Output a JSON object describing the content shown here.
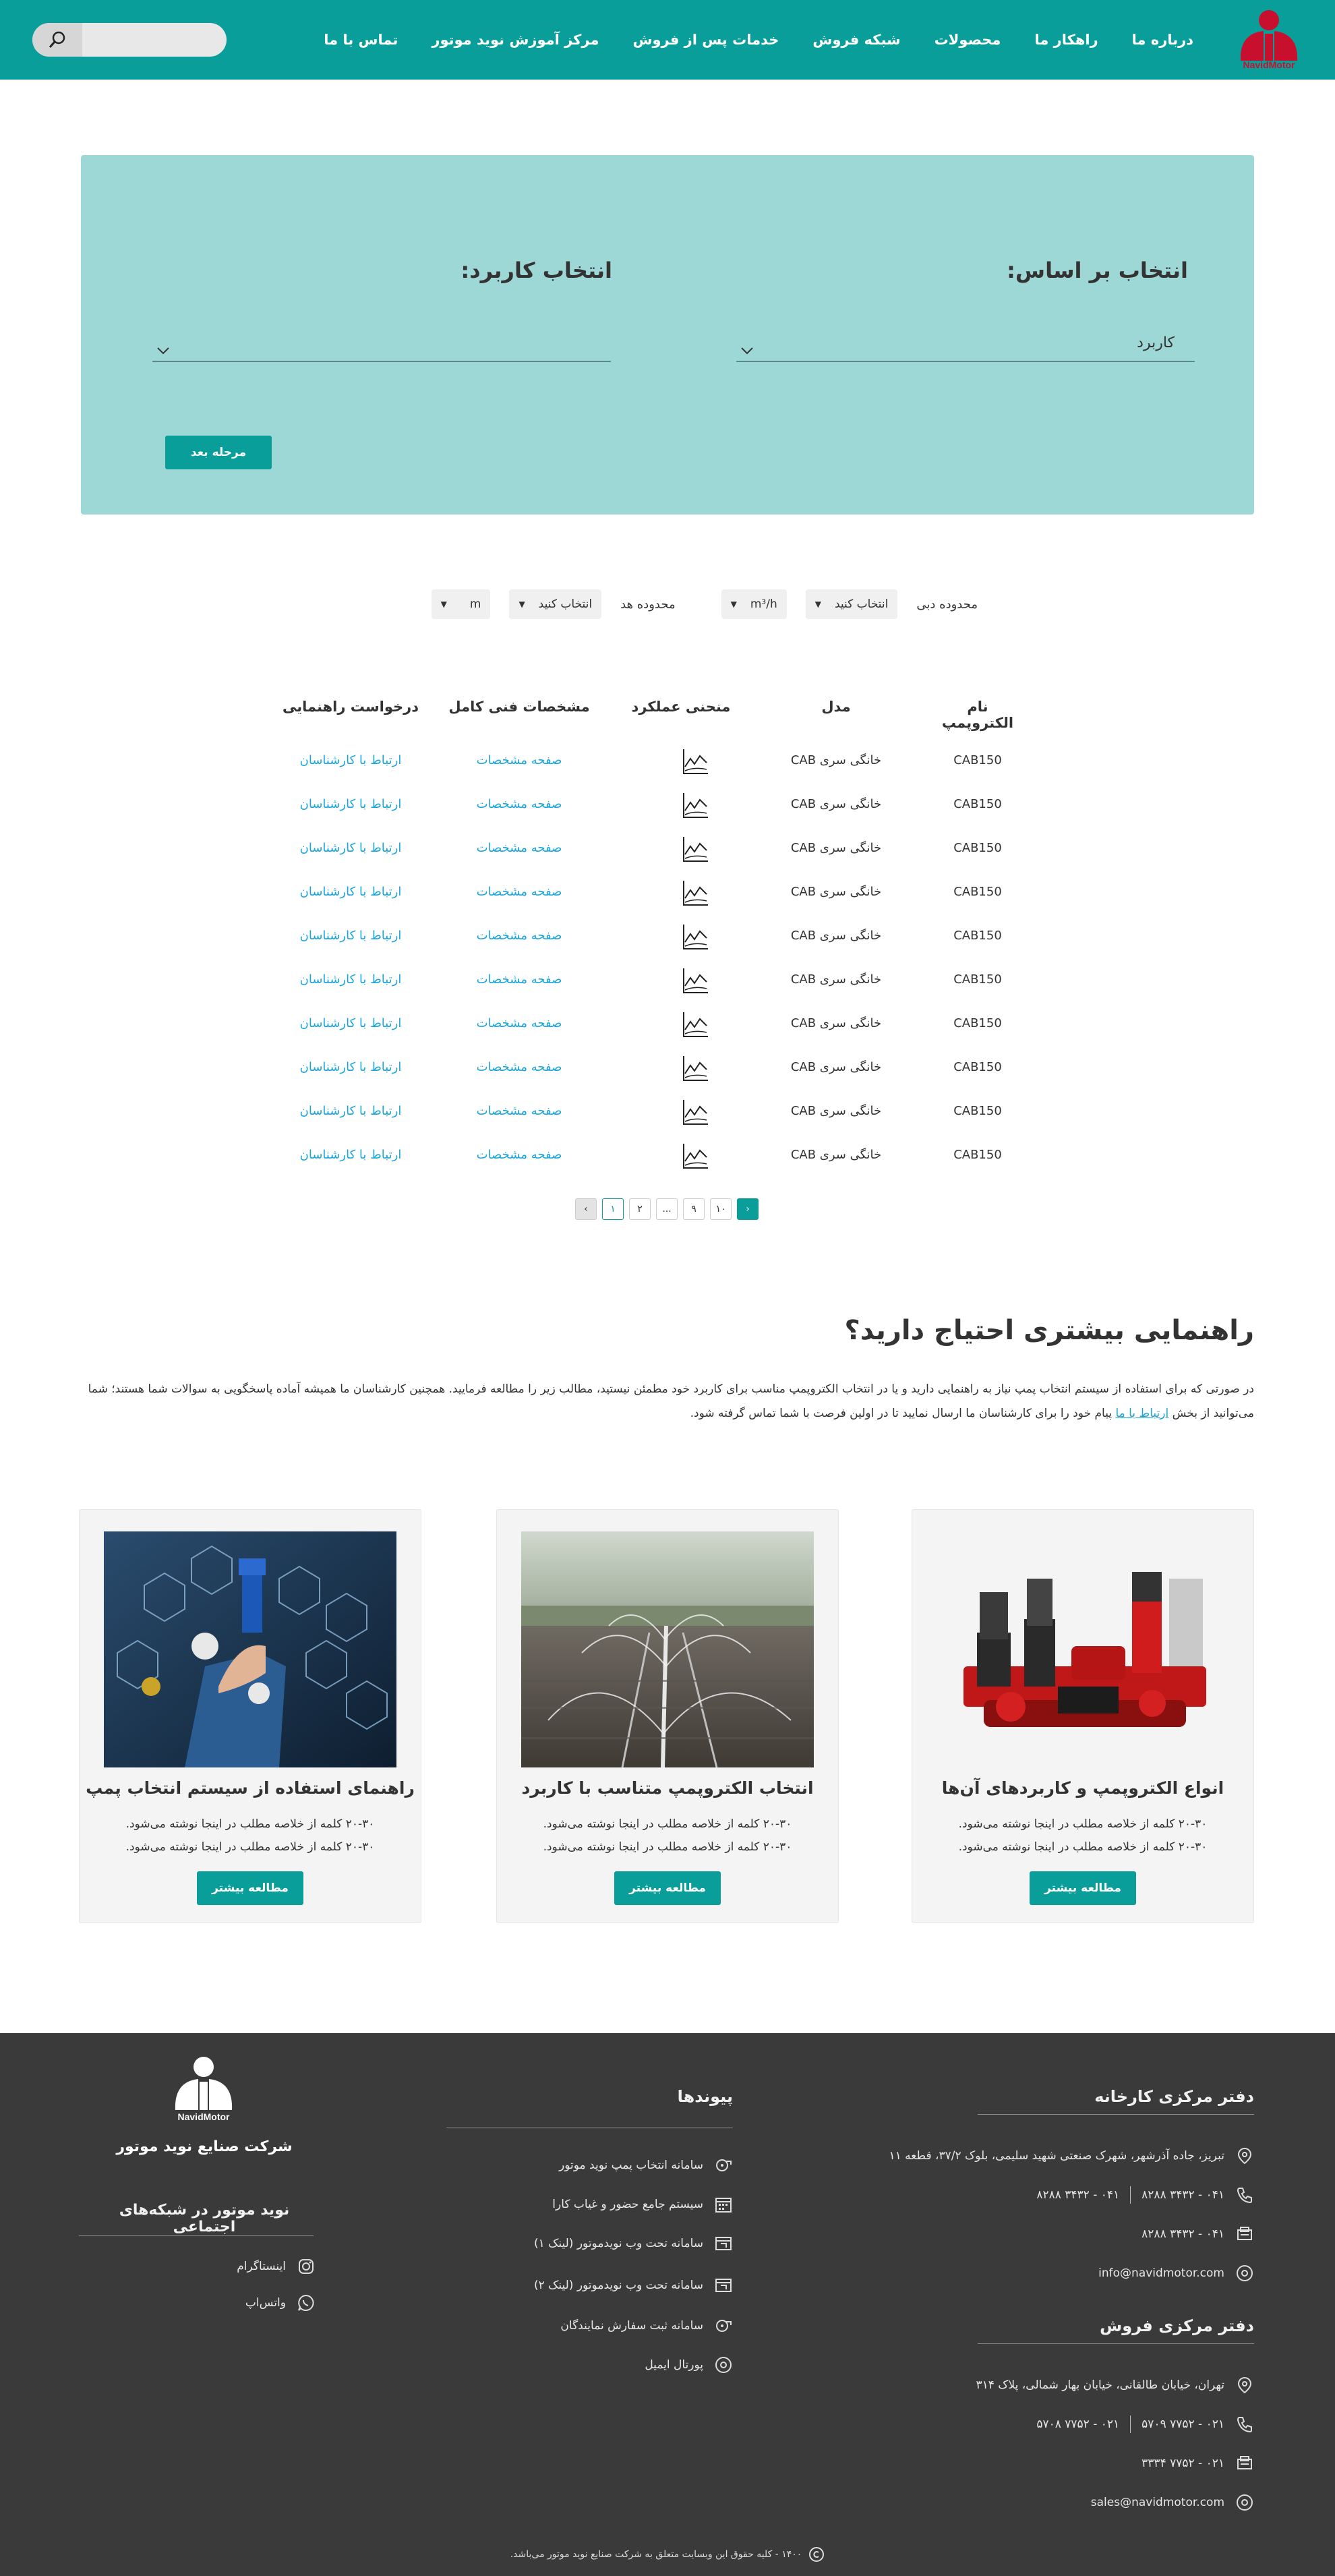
{
  "header": {
    "logo_text": "NavidMotor",
    "nav": [
      "درباره ما",
      "راهکار ما",
      "محصولات",
      "شبکه فروش",
      "خدمات پس از فروش",
      "مرکز آموزش نوید موتور",
      "تماس با ما"
    ],
    "search_placeholder": "",
    "colors": {
      "primary": "#0a9e9a",
      "logo_red": "#c8102e"
    }
  },
  "selection": {
    "basis_title": "انتخاب بر اساس:",
    "basis_value": "کاربرد",
    "usage_title": "انتخاب کاربرد:",
    "usage_value": "",
    "next_button": "مرحله بعد",
    "panel_color": "#9ed8d6"
  },
  "filters": {
    "flow_label": "محدوده دبی",
    "flow_select": "انتخاب کنید",
    "flow_unit": "m³/h",
    "head_label": "محدوده هد",
    "head_select": "انتخاب کنید",
    "head_unit": "m"
  },
  "table": {
    "headers": [
      "نام الکتروپمپ",
      "مدل",
      "منحنی عملکرد",
      "مشخصات فنی کامل",
      "درخواست راهنمایی"
    ],
    "rows": [
      {
        "name": "CAB150",
        "model": "خانگی سری CAB",
        "spec": "صفحه مشخصات",
        "contact": "ارتباط با کارشناسان"
      },
      {
        "name": "CAB150",
        "model": "خانگی سری CAB",
        "spec": "صفحه مشخصات",
        "contact": "ارتباط با کارشناسان"
      },
      {
        "name": "CAB150",
        "model": "خانگی سری CAB",
        "spec": "صفحه مشخصات",
        "contact": "ارتباط با کارشناسان"
      },
      {
        "name": "CAB150",
        "model": "خانگی سری CAB",
        "spec": "صفحه مشخصات",
        "contact": "ارتباط با کارشناسان"
      },
      {
        "name": "CAB150",
        "model": "خانگی سری CAB",
        "spec": "صفحه مشخصات",
        "contact": "ارتباط با کارشناسان"
      },
      {
        "name": "CAB150",
        "model": "خانگی سری CAB",
        "spec": "صفحه مشخصات",
        "contact": "ارتباط با کارشناسان"
      },
      {
        "name": "CAB150",
        "model": "خانگی سری CAB",
        "spec": "صفحه مشخصات",
        "contact": "ارتباط با کارشناسان"
      },
      {
        "name": "CAB150",
        "model": "خانگی سری CAB",
        "spec": "صفحه مشخصات",
        "contact": "ارتباط با کارشناسان"
      },
      {
        "name": "CAB150",
        "model": "خانگی سری CAB",
        "spec": "صفحه مشخصات",
        "contact": "ارتباط با کارشناسان"
      },
      {
        "name": "CAB150",
        "model": "خانگی سری CAB",
        "spec": "صفحه مشخصات",
        "contact": "ارتباط با کارشناسان"
      }
    ]
  },
  "pagination": {
    "pages": [
      "۱",
      "۲",
      "...",
      "۹",
      "۱۰"
    ],
    "current": "۱"
  },
  "help": {
    "title": "راهنمایی بیشتری احتیاج دارید؟",
    "text_before": "در صورتی که برای استفاده از سیستم انتخاب پمپ نیاز به راهنمایی دارید و یا در انتخاب الکتروپمپ مناسب برای کاربرد خود مطمئن نیستید، مطالب زیر را مطالعه فرمایید. همچنین کارشناسان ما همیشه آماده پاسخگویی به سوالات شما هستند؛ شما می‌توانید از بخش ",
    "link": "ارتباط با ما",
    "text_after": " پیام خود را برای کارشناسان ما ارسال نمایید تا در اولین فرصت با شما تماس گرفته شود."
  },
  "cards": [
    {
      "title": "انواع الکتروپمپ و کاربردهای آن‌ها",
      "line1": "۲۰-۳۰ کلمه از خلاصه مطلب در اینجا نوشته می‌شود.",
      "line2": "۲۰-۳۰ کلمه از خلاصه مطلب در اینجا نوشته می‌شود.",
      "button": "مطالعه بیشتر"
    },
    {
      "title": "انتخاب الکتروپمپ متناسب با کاربرد",
      "line1": "۲۰-۳۰ کلمه از خلاصه مطلب در اینجا نوشته می‌شود.",
      "line2": "۲۰-۳۰ کلمه از خلاصه مطلب در اینجا نوشته می‌شود.",
      "button": "مطالعه بیشتر"
    },
    {
      "title": "راهنمای استفاده از سیستم انتخاب پمپ",
      "line1": "۲۰-۳۰ کلمه از خلاصه مطلب در اینجا نوشته می‌شود.",
      "line2": "۲۰-۳۰ کلمه از خلاصه مطلب در اینجا نوشته می‌شود.",
      "button": "مطالعه بیشتر"
    }
  ],
  "footer": {
    "factory": {
      "title": "دفتر مرکزی کارخانه",
      "address": "تبریز، جاده آذرشهر، شهرک صنعتی شهید سلیمی، بلوک ۳۷/۲، قطعه ۱۱",
      "phone1": "۰۴۱ - ۳۴۳۲ ۸۲۸۸",
      "phone2": "۰۴۱ - ۳۴۳۲ ۸۲۸۸",
      "fax": "۰۴۱ - ۳۴۳۲ ۸۲۸۸",
      "email": "info@navidmotor.com"
    },
    "sales": {
      "title": "دفتر مرکزی فروش",
      "address": "تهران، خیابان طالقانی، خیابان بهار شمالی، پلاک ۳۱۴",
      "phone1": "۰۲۱ - ۷۷۵۲ ۵۷۰۹",
      "phone2": "۰۲۱ - ۷۷۵۲ ۵۷۰۸",
      "fax": "۰۲۱ - ۷۷۵۲ ۳۳۳۴",
      "email": "sales@navidmotor.com"
    },
    "links": {
      "title": "پیوندها",
      "items": [
        "سامانه انتخاب پمپ نوید موتور",
        "سیستم جامع حضور و غیاب کارا",
        "سامانه تحت وب نویدموتور (لینک ۱)",
        "سامانه تحت وب نویدموتور (لینک ۲)",
        "سامانه ثبت سفارش نمایندگان",
        "پورتال ایمیل"
      ]
    },
    "company_name": "شرکت صنایع نوید موتور",
    "logo_text": "NavidMotor",
    "social": {
      "title": "نوید موتور در شبکه‌های اجتماعی",
      "items": [
        "اینستاگرام",
        "واتس‌اپ"
      ]
    },
    "copyright": "۱۴۰۰ - کلیه حقوق این وبسایت متعلق به شرکت صنایع نوید موتور می‌باشد."
  }
}
